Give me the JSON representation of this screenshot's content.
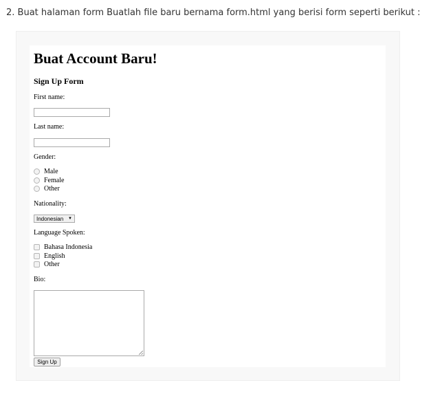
{
  "instruction": "2. Buat halaman form Buatlah file baru bernama form.html yang berisi form seperti berikut :",
  "form": {
    "heading": "Buat Account Baru!",
    "subheading": "Sign Up Form",
    "first_name_label": "First name:",
    "first_name_value": "",
    "last_name_label": "Last name:",
    "last_name_value": "",
    "gender_label": "Gender:",
    "gender_options": [
      "Male",
      "Female",
      "Other"
    ],
    "nationality_label": "Nationality:",
    "nationality_selected": "Indonesian",
    "language_label": "Language Spoken:",
    "language_options": [
      "Bahasa Indonesia",
      "English",
      "Other"
    ],
    "bio_label": "Bio:",
    "bio_value": "",
    "submit_label": "Sign Up"
  }
}
